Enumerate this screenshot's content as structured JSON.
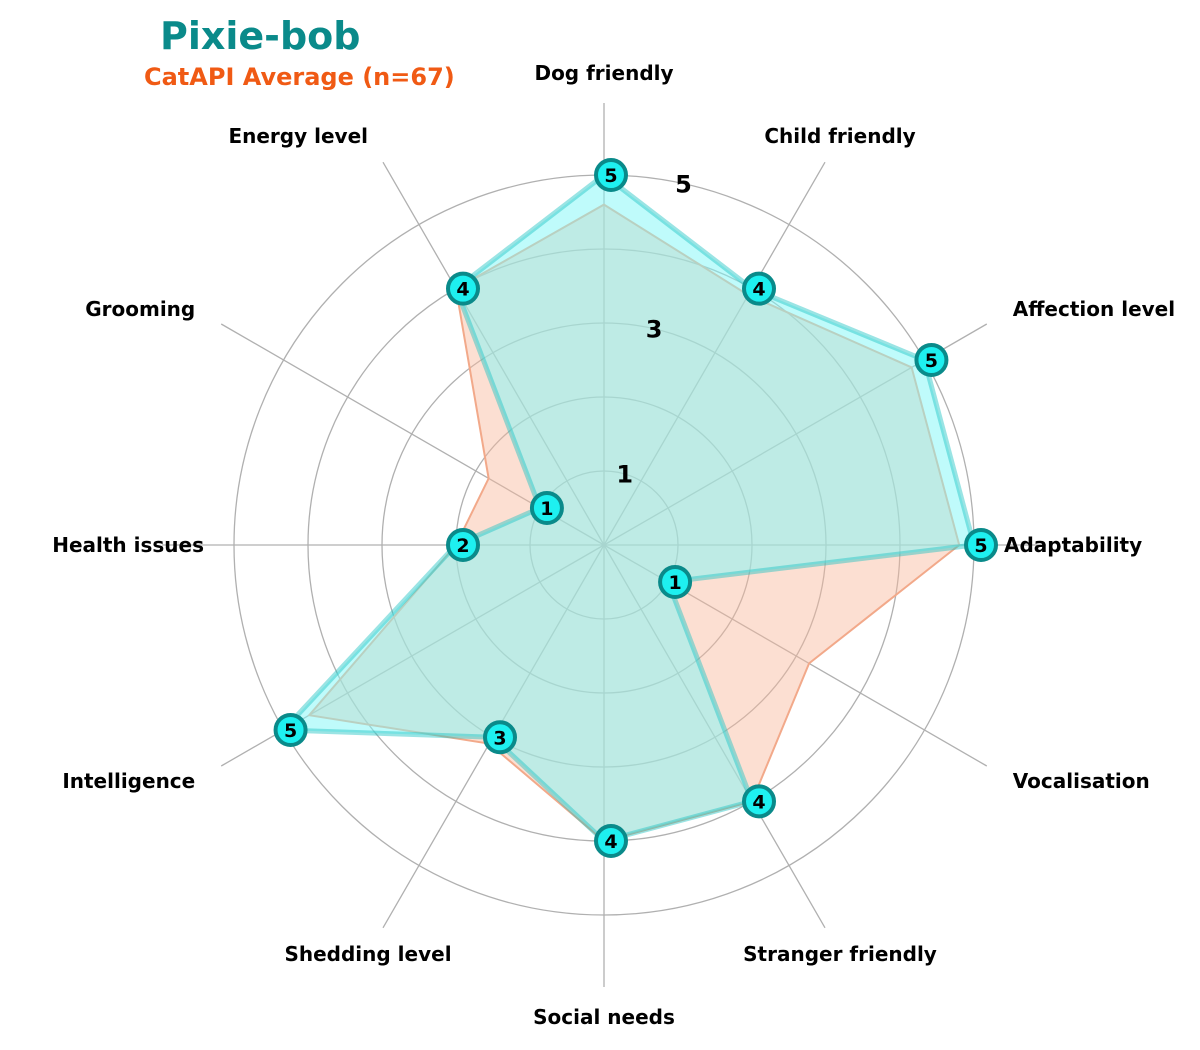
{
  "chart_data": {
    "type": "radar",
    "title": "Pixie-bob",
    "subtitle": "CatAPI Average (n=67)",
    "axes": [
      "Dog friendly",
      "Child friendly",
      "Affection level",
      "Adaptability",
      "Vocalisation",
      "Stranger friendly",
      "Social needs",
      "Shedding level",
      "Intelligence",
      "Health issues",
      "Grooming",
      "Energy level"
    ],
    "rlim": [
      0,
      5
    ],
    "rticks": [
      1,
      3,
      5
    ],
    "grid": true,
    "series": [
      {
        "name": "Pixie-bob",
        "values": [
          5,
          4,
          5,
          5,
          1,
          4,
          4,
          3,
          5,
          2,
          1,
          4
        ]
      },
      {
        "name": "CatAPI Average (n=67)",
        "values": [
          4.6,
          3.9,
          4.8,
          4.8,
          3.2,
          4.0,
          4.0,
          3.1,
          4.6,
          2.0,
          1.8,
          4.0
        ]
      }
    ],
    "colors": {
      "breed_fill": "#7ff8f8",
      "breed_line": "#20c4c4",
      "marker_fill": "#1ef0f0",
      "marker_edge": "#0a8a8a",
      "average_fill": "#f9b89c",
      "average_line": "#f2a98a",
      "grid": "#b0b0b0",
      "title": "#0a8a8a",
      "subtitle": "#f05a14"
    }
  }
}
